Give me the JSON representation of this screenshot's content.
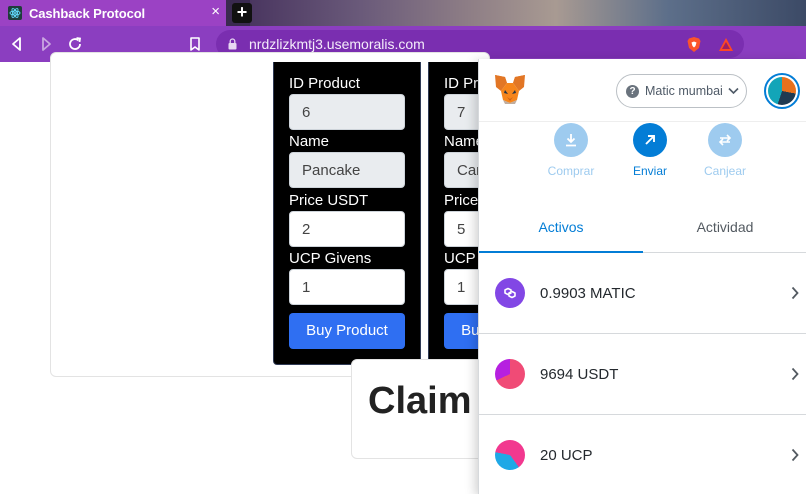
{
  "browser": {
    "tab_title": "Cashback Protocol",
    "tab_close": "×",
    "new_tab": "+",
    "url": "nrdzlizkmtj3.usemoralis.com"
  },
  "products": [
    {
      "id_label": "ID Product",
      "id_value": "6",
      "name_label": "Name",
      "name_value": "Pancake",
      "price_label": "Price USDT",
      "price_value": "2",
      "ucp_label": "UCP Givens",
      "ucp_value": "1",
      "button": "Buy Product"
    },
    {
      "id_label": "ID Product",
      "id_value": "7",
      "name_label": "Name",
      "name_value": "Car",
      "price_label": "Price USDT",
      "price_value": "5",
      "ucp_label": "UCP Givens",
      "ucp_value": "1",
      "button": "Buy Product"
    }
  ],
  "claim": {
    "title": "Claim C"
  },
  "metamask": {
    "network": "Matic mumbai",
    "network_info": "?",
    "actions": [
      {
        "label": "Comprar",
        "icon": "download-icon"
      },
      {
        "label": "Enviar",
        "icon": "arrow-up-right-icon"
      },
      {
        "label": "Canjear",
        "icon": "swap-icon"
      }
    ],
    "tabs": [
      "Activos",
      "Actividad"
    ],
    "assets": [
      {
        "text": "0.9903 MATIC",
        "icon": "polygon-token-icon"
      },
      {
        "text": "9694 USDT",
        "icon": "usdt-token-icon"
      },
      {
        "text": "20 UCP",
        "icon": "ucp-token-icon"
      }
    ]
  },
  "colors": {
    "tab_purple": "#9b42c4",
    "toolbar_purple": "#8b3ec0",
    "metamask_blue": "#037dd6",
    "buy_button": "#2f6ff2",
    "matic_purple": "#8247e5"
  }
}
